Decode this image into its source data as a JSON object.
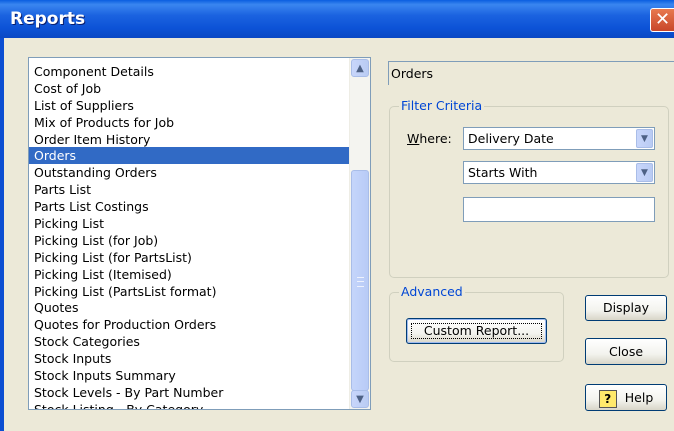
{
  "window": {
    "title": "Reports",
    "close_glyph": "✕"
  },
  "report_list": {
    "items": [
      "Component Details",
      "Cost of Job",
      "List of Suppliers",
      "Mix of Products for Job",
      "Order Item History",
      "Orders",
      "Outstanding Orders",
      "Parts List",
      "Parts List Costings",
      "Picking List",
      "Picking List (for Job)",
      "Picking List (for PartsList)",
      "Picking List (Itemised)",
      "Picking List (PartsList format)",
      "Quotes",
      "Quotes for Production Orders",
      "Stock Categories",
      "Stock Inputs",
      "Stock Inputs Summary",
      "Stock Levels - By Part Number",
      "Stock Listing - By Category"
    ],
    "selected": "Orders",
    "scroll_up_glyph": "▲",
    "scroll_down_glyph": "▼"
  },
  "selected_report_name": "Orders",
  "filter": {
    "title": "Filter Criteria",
    "where_label": "Where:",
    "field_value": "Delivery Date",
    "operator_value": "Starts With",
    "text_value": "",
    "dropdown_glyph": "▼"
  },
  "advanced": {
    "title": "Advanced",
    "custom_report_label": "Custom Report..."
  },
  "buttons": {
    "display": "Display",
    "close": "Close",
    "help": "Help",
    "help_icon_glyph": "?"
  },
  "colors": {
    "titlebar": "#0a48c4",
    "selection": "#316ac5",
    "group_title": "#0046d5",
    "close_button": "#c8462a"
  }
}
